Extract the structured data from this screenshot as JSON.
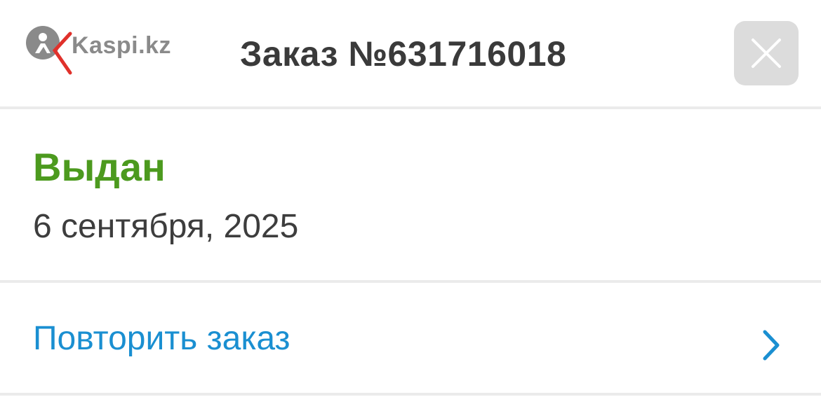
{
  "header": {
    "logo_text": "Kaspi.kz",
    "order_title": "Заказ №631716018",
    "close_icon": "close-icon"
  },
  "order": {
    "status": "Выдан",
    "date": "6 сентября, 2025"
  },
  "actions": {
    "repeat_label": "Повторить заказ",
    "chevron_icon": "chevron-right-icon"
  },
  "colors": {
    "status_green": "#4c9a1e",
    "link_blue": "#1a8fd1",
    "logo_red": "#e0312b",
    "close_bg": "#dcdcdc"
  }
}
